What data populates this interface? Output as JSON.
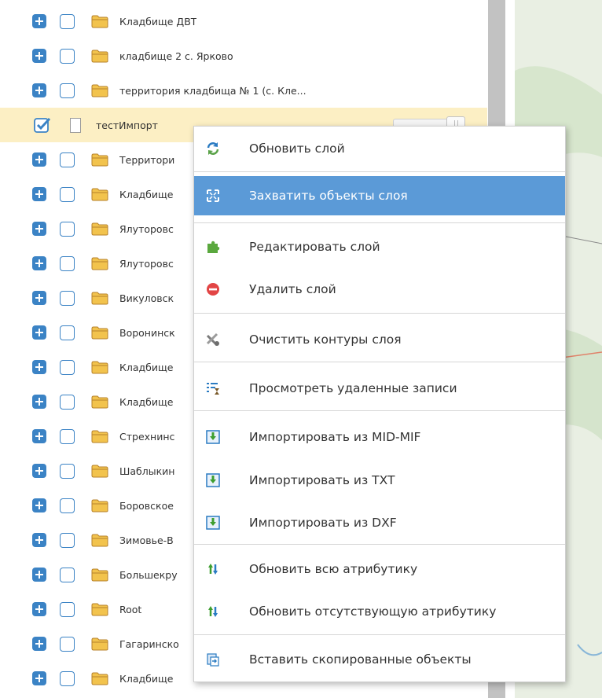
{
  "tree": {
    "rows_before": [
      {
        "label": "Кладбище ДВТ"
      },
      {
        "label": "кладбище 2 с. Ярково"
      },
      {
        "label": "территория кладбища № 1 (с. Кле..."
      }
    ],
    "selected_row": {
      "label": "тестИмпорт"
    },
    "rows_after": [
      {
        "label": "Территори"
      },
      {
        "label": "Кладбище"
      },
      {
        "label": "Ялуторовс"
      },
      {
        "label": "Ялуторовс"
      },
      {
        "label": "Викуловск"
      },
      {
        "label": "Воронинск"
      },
      {
        "label": "Кладбище"
      },
      {
        "label": "Кладбище"
      },
      {
        "label": "Стрехнинс"
      },
      {
        "label": "Шаблыкин"
      },
      {
        "label": "Боровское"
      },
      {
        "label": "Зимовье-В"
      },
      {
        "label": "Большекру"
      },
      {
        "label": "Root"
      },
      {
        "label": "Гагаринско"
      },
      {
        "label": "Кладбище"
      },
      {
        "label": "кладбище"
      }
    ]
  },
  "context_menu": {
    "items": [
      {
        "label": "Обновить слой",
        "icon": "refresh-icon"
      },
      {
        "label": "Захватить объекты слоя",
        "icon": "capture-objects-icon",
        "highlighted": true
      },
      {
        "label": "Редактировать слой",
        "icon": "puzzle-edit-icon"
      },
      {
        "label": "Удалить слой",
        "icon": "delete-circle-icon"
      },
      {
        "label": "Очистить контуры слоя",
        "icon": "clear-contours-icon"
      },
      {
        "label": "Просмотреть удаленные записи",
        "icon": "deleted-records-icon"
      },
      {
        "label": "Импортировать из MID-MIF",
        "icon": "import-icon"
      },
      {
        "label": "Импортировать из TXT",
        "icon": "import-icon"
      },
      {
        "label": "Импортировать из DXF",
        "icon": "import-icon"
      },
      {
        "label": "Обновить всю атрибутику",
        "icon": "update-attributes-icon"
      },
      {
        "label": "Обновить отсутствующую атрибутику",
        "icon": "update-attributes-icon"
      },
      {
        "label": "Вставить скопированные объекты",
        "icon": "paste-objects-icon"
      }
    ]
  },
  "colors": {
    "accent": "#3b83c5",
    "menu_highlight": "#5b9ad7",
    "selected_row": "#fcefc4",
    "folder": "#e2a92c"
  }
}
